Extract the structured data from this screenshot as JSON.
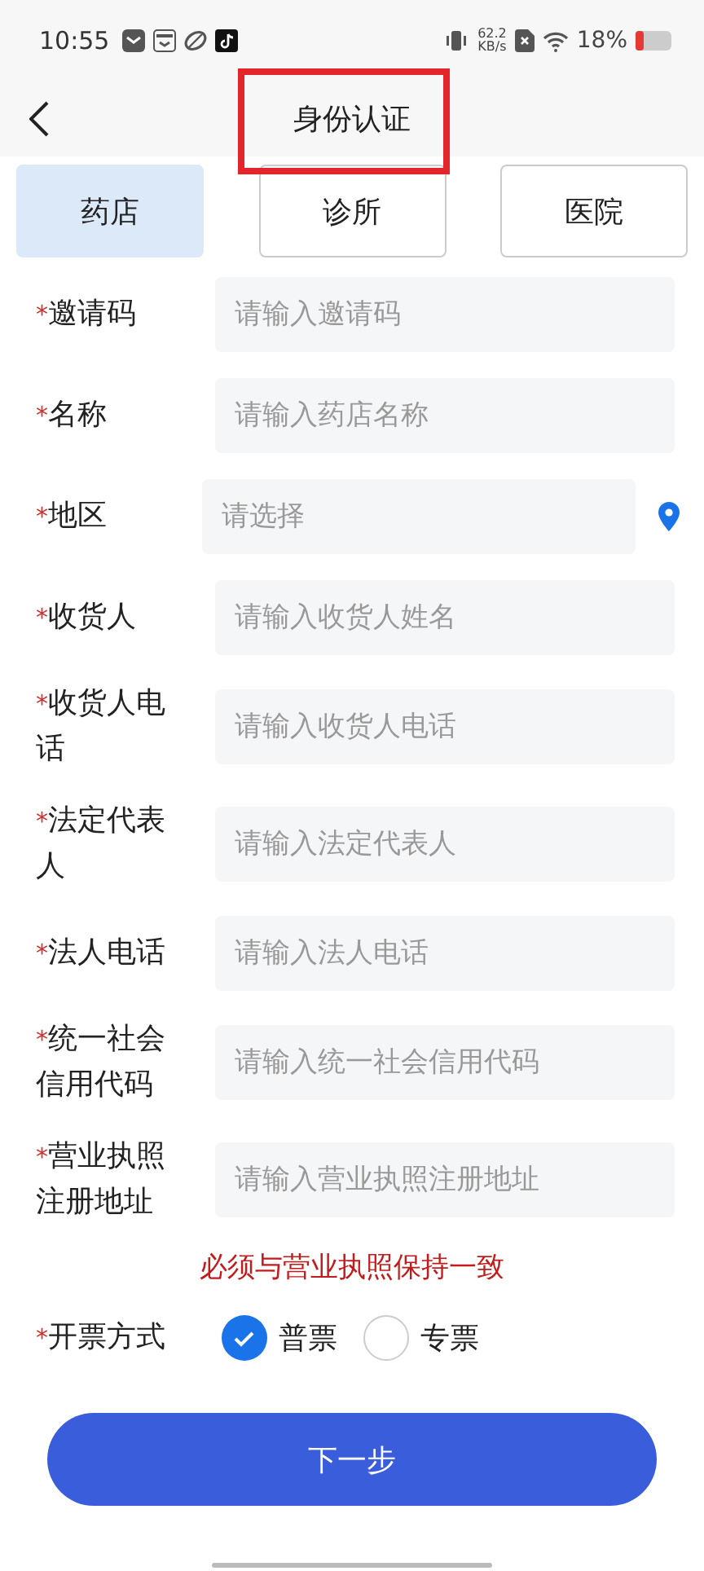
{
  "status_bar": {
    "time": "10:55",
    "net_speed": "62.2",
    "net_unit": "KB/s",
    "battery": "18%"
  },
  "header": {
    "title": "身份认证"
  },
  "tabs": [
    {
      "label": "药店",
      "selected": true
    },
    {
      "label": "诊所",
      "selected": false
    },
    {
      "label": "医院",
      "selected": false
    }
  ],
  "fields": [
    {
      "kind": "input",
      "marker": "*",
      "label": "邀请码",
      "placeholder": "请输入邀请码"
    },
    {
      "kind": "input",
      "marker": "*",
      "label": "名称",
      "placeholder": "请输入药店名称"
    },
    {
      "kind": "select",
      "marker": "*",
      "label": "地区",
      "placeholder": "请选择"
    },
    {
      "kind": "input",
      "marker": "*",
      "label": "收货人",
      "placeholder": "请输入收货人姓名"
    },
    {
      "kind": "input",
      "marker": "*",
      "label": "收货人电话",
      "placeholder": "请输入收货人电话"
    },
    {
      "kind": "input",
      "marker": "*",
      "label": "法定代表人",
      "placeholder": "请输入法定代表人"
    },
    {
      "kind": "input",
      "marker": "*",
      "label": "法人电话",
      "placeholder": "请输入法人电话"
    },
    {
      "kind": "input",
      "marker": "*",
      "label": "统一社会信用代码",
      "placeholder": "请输入统一社会信用代码"
    },
    {
      "kind": "input",
      "marker": "*",
      "label": "营业执照注册地址",
      "placeholder": "请输入营业执照注册地址"
    }
  ],
  "note": "必须与营业执照保持一致",
  "invoice": {
    "marker": "*",
    "label": "开票方式",
    "options": [
      {
        "label": "普票",
        "selected": true
      },
      {
        "label": "专票",
        "selected": false
      }
    ]
  },
  "next_button": "下一步"
}
